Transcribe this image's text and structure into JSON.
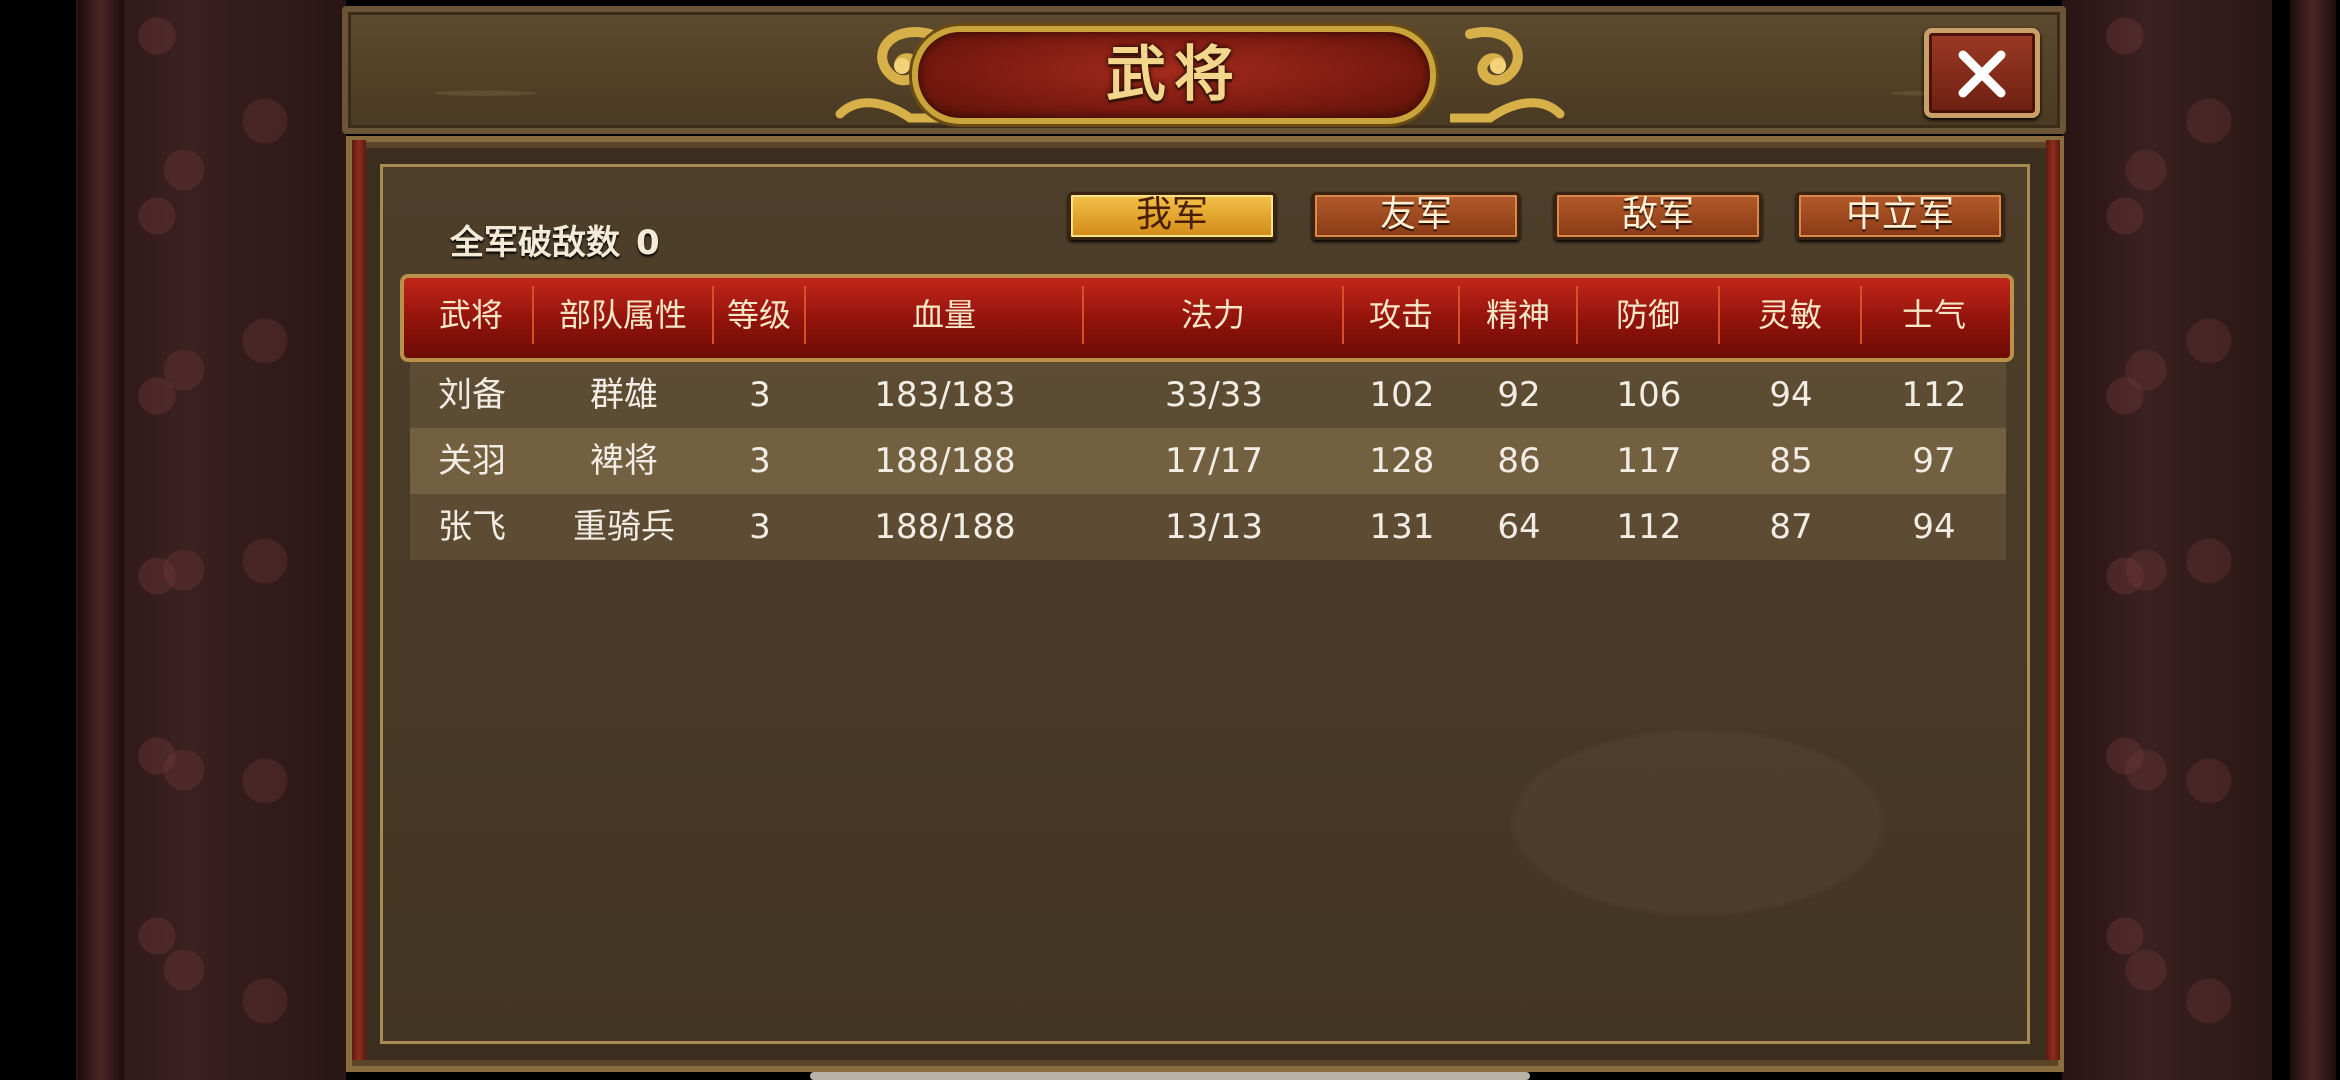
{
  "title": "武将",
  "close_icon": "close-icon",
  "kill_count": {
    "label": "全军破敌数",
    "value": "0"
  },
  "tabs": [
    {
      "label": "我军",
      "active": true
    },
    {
      "label": "友军",
      "active": false
    },
    {
      "label": "敌军",
      "active": false
    },
    {
      "label": "中立军",
      "active": false
    }
  ],
  "table": {
    "headers": [
      "武将",
      "部队属性",
      "等级",
      "血量",
      "法力",
      "攻击",
      "精神",
      "防御",
      "灵敏",
      "士气"
    ],
    "rows": [
      [
        "刘备",
        "群雄",
        "3",
        "183/183",
        "33/33",
        "102",
        "92",
        "106",
        "94",
        "112"
      ],
      [
        "关羽",
        "裨将",
        "3",
        "188/188",
        "17/17",
        "128",
        "86",
        "117",
        "85",
        "97"
      ],
      [
        "张飞",
        "重骑兵",
        "3",
        "188/188",
        "13/13",
        "131",
        "64",
        "112",
        "87",
        "94"
      ]
    ]
  },
  "colors": {
    "header_red": "#9e1a10",
    "active_tab": "#e8a82e",
    "inactive_tab": "#a04a20",
    "title_gold": "#f1d68c"
  }
}
